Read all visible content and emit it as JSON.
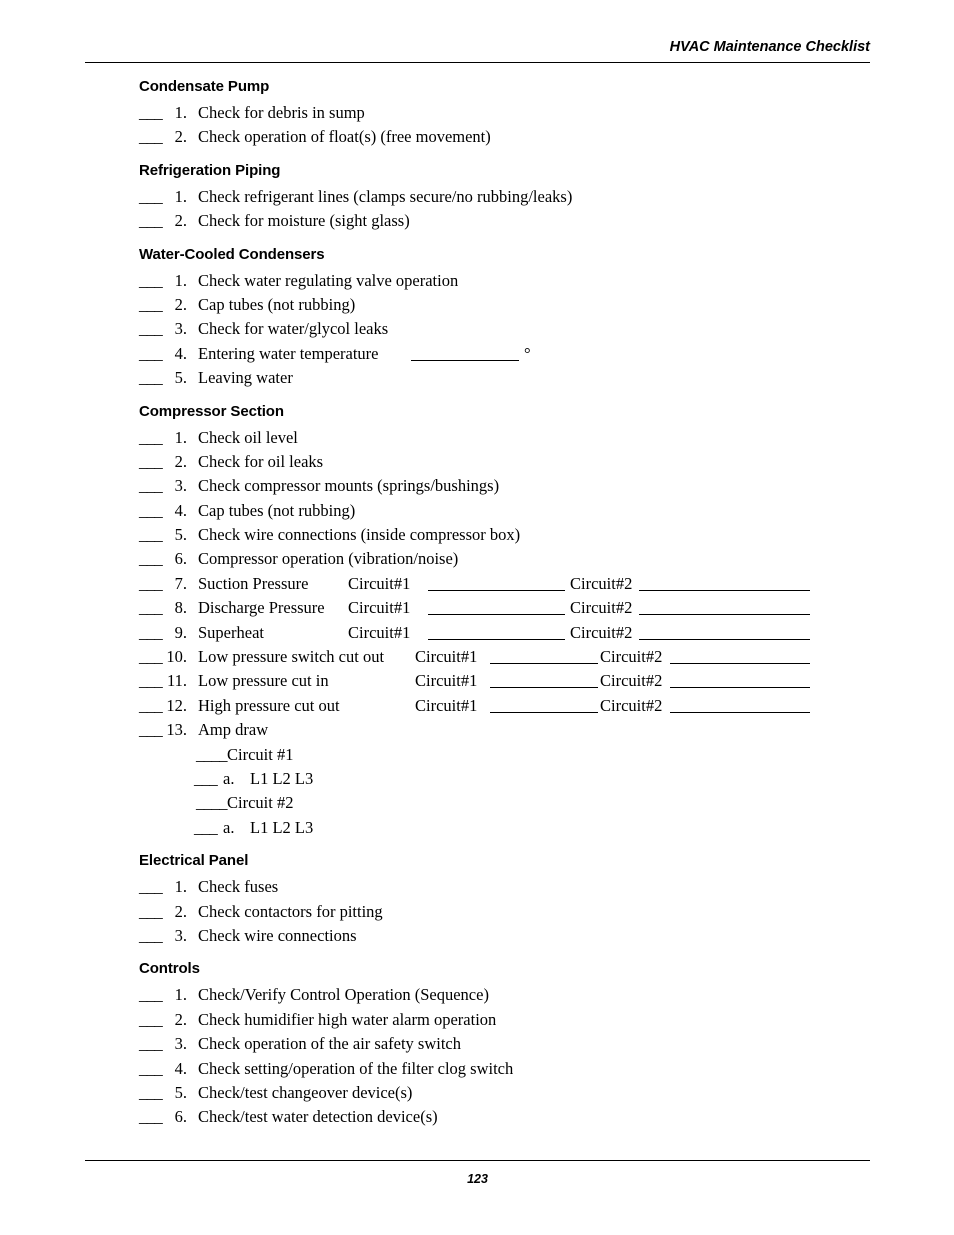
{
  "header": {
    "running_head": "HVAC Maintenance Checklist"
  },
  "footer": {
    "page_number": "123"
  },
  "blank_mark": "___",
  "blank_mark_long": "____",
  "degree_symbol": "°",
  "circuit1_label": "Circuit#1",
  "circuit2_label": "Circuit#2",
  "sections": [
    {
      "id": "condensate-pump",
      "title": "Condensate Pump",
      "items": [
        {
          "num": "1.",
          "text": "Check for debris in sump"
        },
        {
          "num": "2.",
          "text": "Check operation of float(s) (free movement)"
        }
      ]
    },
    {
      "id": "refrigeration-piping",
      "title": "Refrigeration Piping",
      "items": [
        {
          "num": "1.",
          "text": "Check refrigerant lines (clamps secure/no rubbing/leaks)"
        },
        {
          "num": "2.",
          "text": "Check for moisture (sight glass)"
        }
      ]
    },
    {
      "id": "water-cooled-condensers",
      "title": "Water-Cooled Condensers",
      "items": [
        {
          "num": "1.",
          "text": "Check water regulating valve operation"
        },
        {
          "num": "2.",
          "text": "Cap tubes (not rubbing)"
        },
        {
          "num": "3.",
          "text": "Check for water/glycol leaks"
        },
        {
          "num": "4.",
          "text": "Entering water temperature"
        },
        {
          "num": "5.",
          "text": "Leaving water"
        }
      ]
    },
    {
      "id": "compressor-section",
      "title": "Compressor Section",
      "items": [
        {
          "num": "1.",
          "text": "Check oil level"
        },
        {
          "num": "2.",
          "text": "Check for oil leaks"
        },
        {
          "num": "3.",
          "text": "Check compressor mounts (springs/bushings)"
        },
        {
          "num": "4.",
          "text": "Cap tubes (not rubbing)"
        },
        {
          "num": "5.",
          "text": "Check wire connections (inside compressor box)"
        },
        {
          "num": "6.",
          "text": "Compressor operation (vibration/noise)"
        },
        {
          "num": "7.",
          "text": "Suction Pressure"
        },
        {
          "num": "8.",
          "text": "Discharge Pressure"
        },
        {
          "num": "9.",
          "text": "Superheat"
        },
        {
          "num": "10.",
          "text": "Low pressure switch cut out"
        },
        {
          "num": "11.",
          "text": "Low pressure cut in"
        },
        {
          "num": "12.",
          "text": "High pressure cut out"
        },
        {
          "num": "13.",
          "text": "Amp draw"
        }
      ],
      "subitems": [
        {
          "blank": "____",
          "text": "Circuit #1"
        },
        {
          "blank": "___",
          "letter": "a.",
          "text": "L1 L2 L3"
        },
        {
          "blank": "____",
          "text": "Circuit #2"
        },
        {
          "blank": "___",
          "letter": "a.",
          "text": "L1 L2 L3"
        }
      ]
    },
    {
      "id": "electrical-panel",
      "title": "Electrical Panel",
      "items": [
        {
          "num": "1.",
          "text": "Check fuses"
        },
        {
          "num": "2.",
          "text": "Check contactors for pitting"
        },
        {
          "num": "3.",
          "text": "Check wire connections"
        }
      ]
    },
    {
      "id": "controls",
      "title": "Controls",
      "items": [
        {
          "num": "1.",
          "text": "Check/Verify Control Operation (Sequence)"
        },
        {
          "num": "2.",
          "text": "Check humidifier high water alarm operation"
        },
        {
          "num": "3.",
          "text": "Check operation of the air safety switch"
        },
        {
          "num": "4.",
          "text": "Check setting/operation of the filter clog switch"
        },
        {
          "num": "5.",
          "text": "Check/test changeover device(s)"
        },
        {
          "num": "6.",
          "text": "Check/test water detection device(s)"
        }
      ]
    }
  ]
}
